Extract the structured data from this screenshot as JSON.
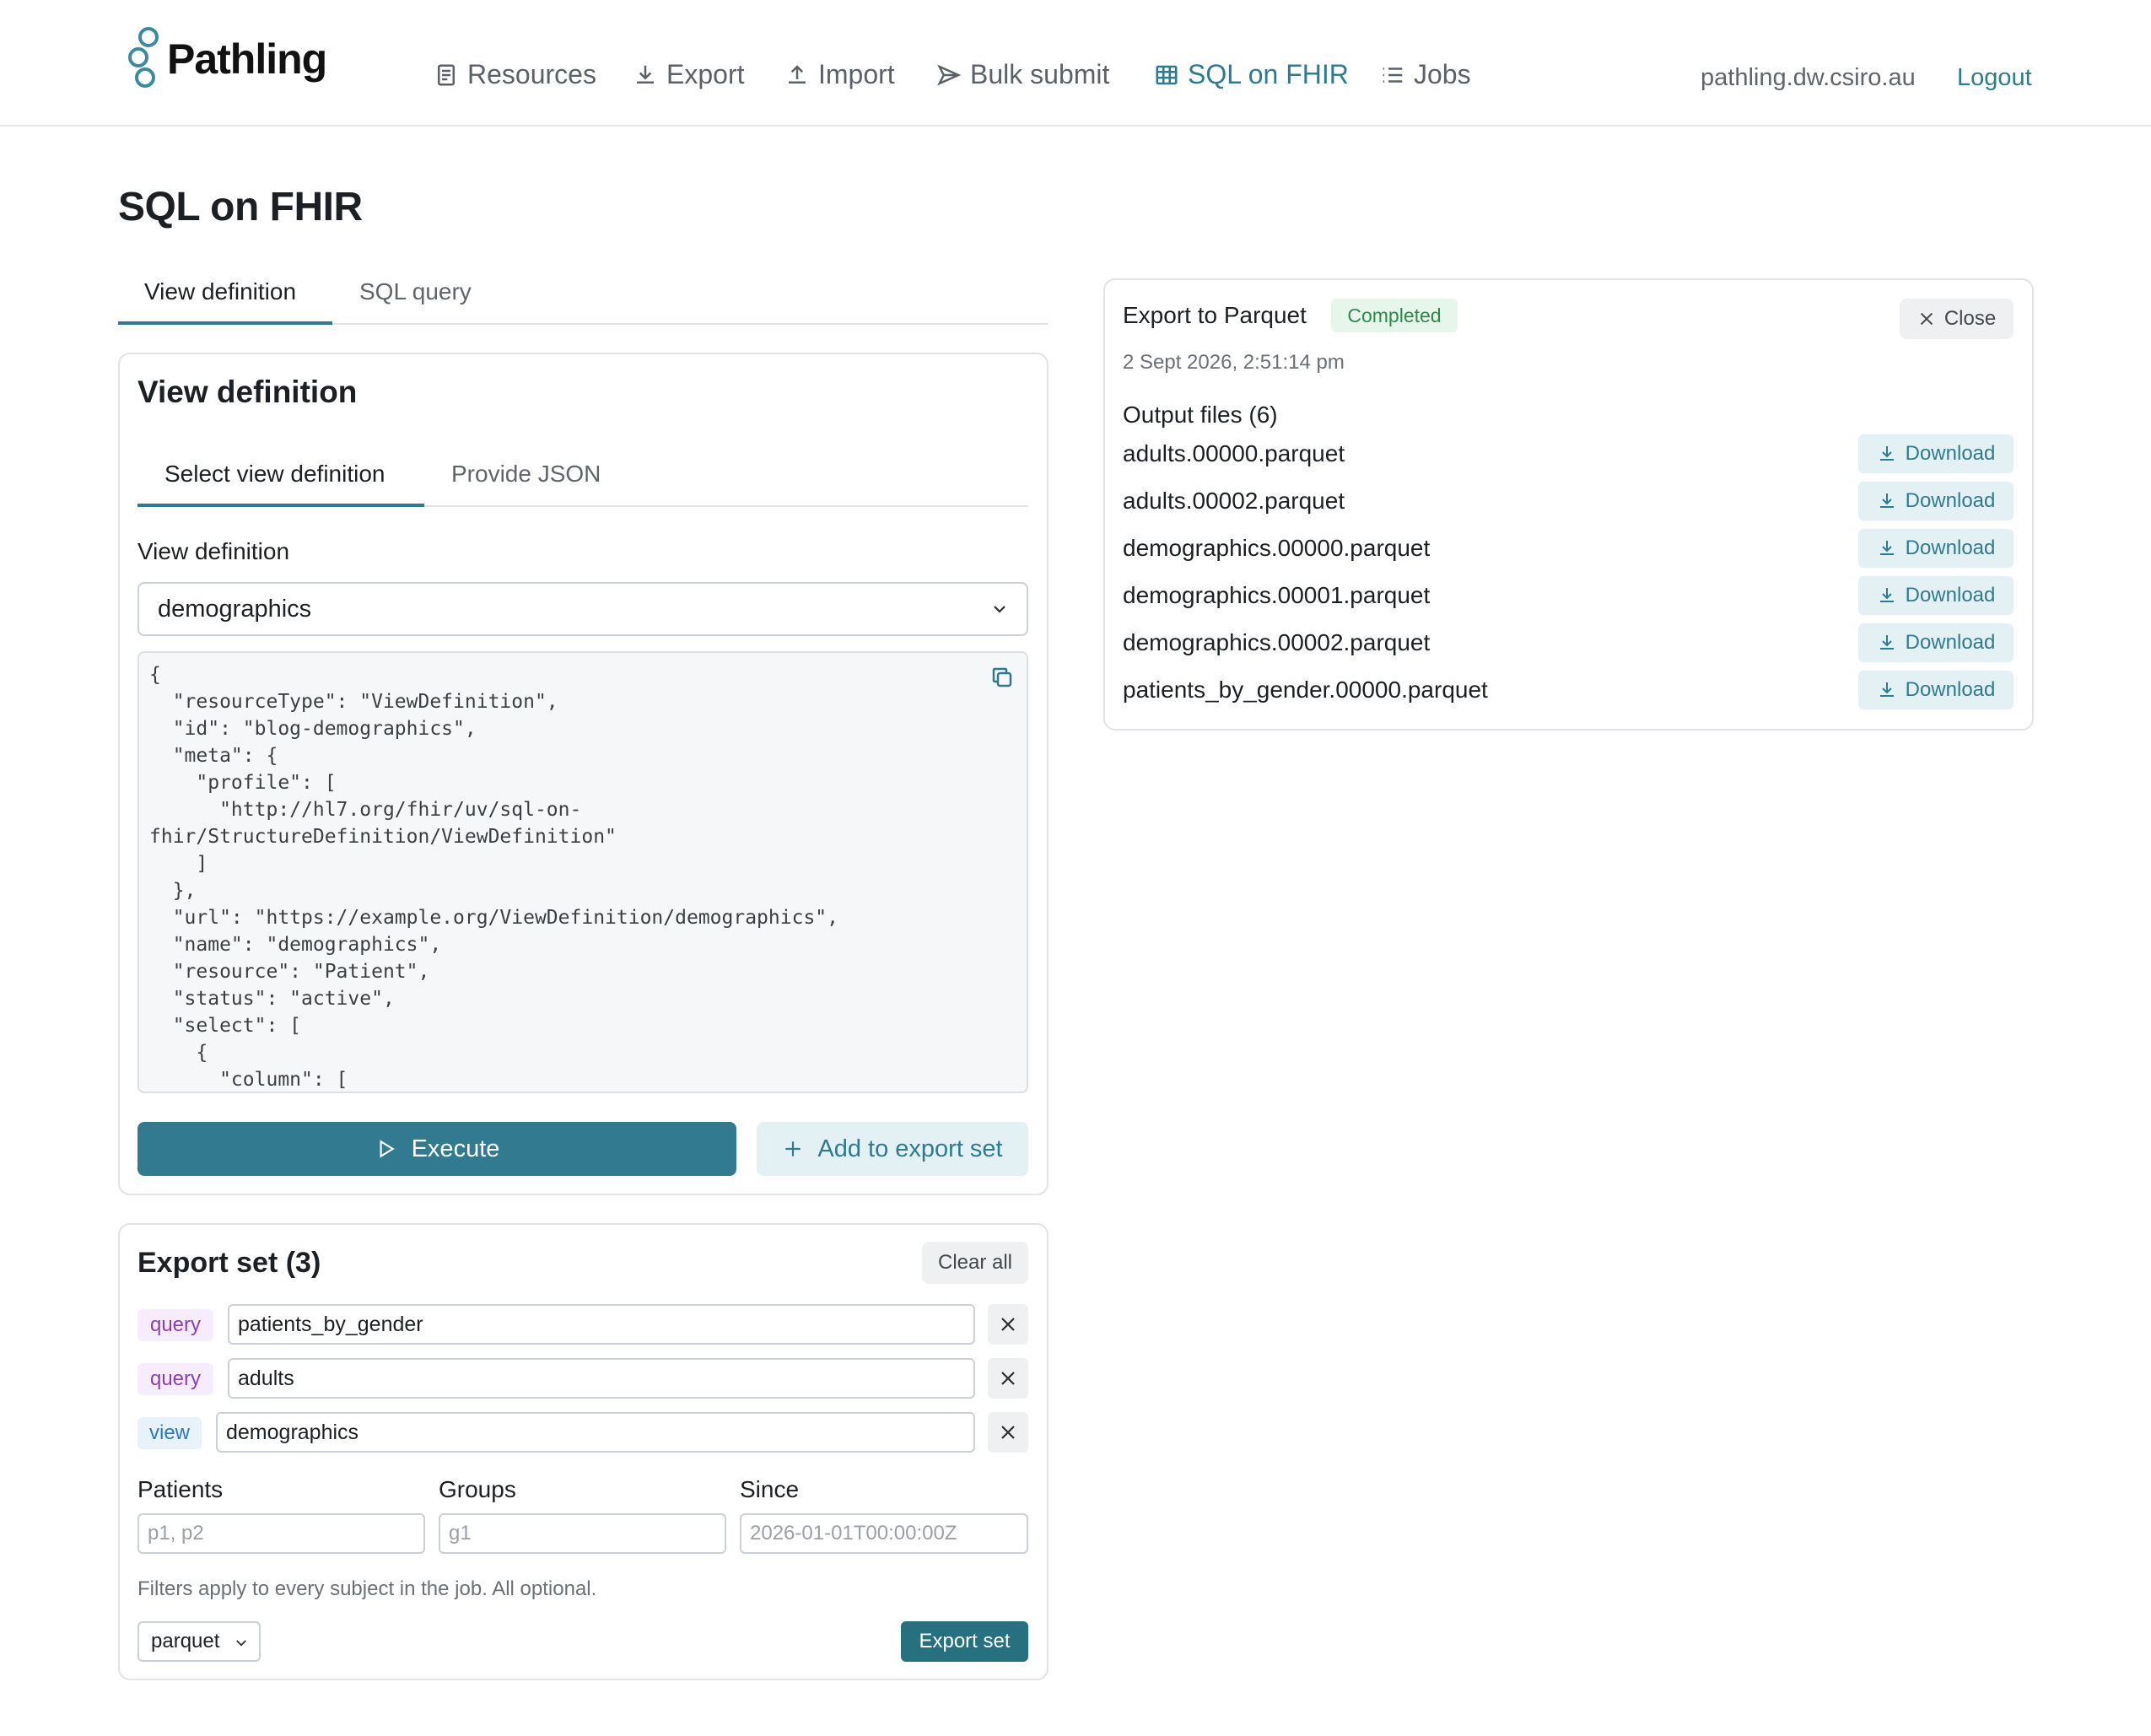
{
  "brand": {
    "name": "Pathling"
  },
  "nav": [
    {
      "label": "Resources",
      "icon": "document-icon"
    },
    {
      "label": "Export",
      "icon": "download-icon"
    },
    {
      "label": "Import",
      "icon": "upload-icon"
    },
    {
      "label": "Bulk submit",
      "icon": "send-icon"
    },
    {
      "label": "SQL on FHIR",
      "icon": "table-icon",
      "active": true
    },
    {
      "label": "Jobs",
      "icon": "list-icon"
    }
  ],
  "header": {
    "host": "pathling.dw.csiro.au",
    "logout": "Logout"
  },
  "page": {
    "title": "SQL on FHIR"
  },
  "main_tabs": [
    {
      "label": "View definition",
      "active": true
    },
    {
      "label": "SQL query",
      "active": false
    }
  ],
  "view_card": {
    "title": "View definition",
    "sub_tabs": [
      {
        "label": "Select view definition",
        "active": true
      },
      {
        "label": "Provide JSON",
        "active": false
      }
    ],
    "field_label": "View definition",
    "selected": "demographics",
    "json_preview": "{\n  \"resourceType\": \"ViewDefinition\",\n  \"id\": \"blog-demographics\",\n  \"meta\": {\n    \"profile\": [\n      \"http://hl7.org/fhir/uv/sql-on-\nfhir/StructureDefinition/ViewDefinition\"\n    ]\n  },\n  \"url\": \"https://example.org/ViewDefinition/demographics\",\n  \"name\": \"demographics\",\n  \"resource\": \"Patient\",\n  \"status\": \"active\",\n  \"select\": [\n    {\n      \"column\": [\n        {",
    "execute_label": "Execute",
    "add_label": "Add to export set"
  },
  "export_set": {
    "title": "Export set (3)",
    "clear_label": "Clear all",
    "items": [
      {
        "kind": "query",
        "name": "patients_by_gender"
      },
      {
        "kind": "query",
        "name": "adults"
      },
      {
        "kind": "view",
        "name": "demographics"
      }
    ],
    "filters": {
      "patients_label": "Patients",
      "patients_placeholder": "p1, p2",
      "groups_label": "Groups",
      "groups_placeholder": "g1",
      "since_label": "Since",
      "since_placeholder": "2026-01-01T00:00:00Z"
    },
    "hint": "Filters apply to every subject in the job. All optional.",
    "format": "parquet",
    "submit_label": "Export set"
  },
  "job": {
    "title": "Export to Parquet",
    "status": "Completed",
    "close_label": "Close",
    "timestamp": "2 Sept 2026, 2:51:14 pm",
    "files_heading": "Output files (6)",
    "download_label": "Download",
    "files": [
      "adults.00000.parquet",
      "adults.00002.parquet",
      "demographics.00000.parquet",
      "demographics.00001.parquet",
      "demographics.00002.parquet",
      "patients_by_gender.00000.parquet"
    ]
  },
  "colors": {
    "accent": "#327a8f",
    "success": "#2f8a4a",
    "query": "#8e3fb0",
    "view": "#2a78c2"
  }
}
